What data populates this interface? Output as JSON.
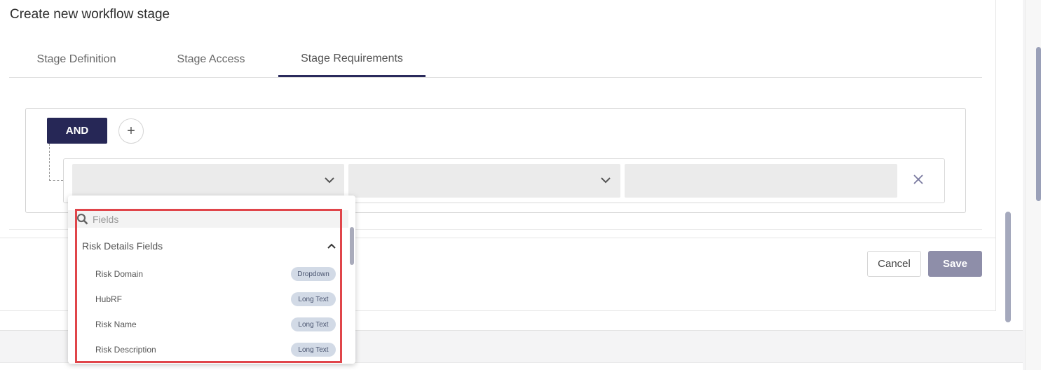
{
  "dialog": {
    "title": "Create new workflow stage"
  },
  "tabs": [
    {
      "label": "Stage Definition",
      "active": false
    },
    {
      "label": "Stage Access",
      "active": false
    },
    {
      "label": "Stage Requirements",
      "active": true
    }
  ],
  "builder": {
    "operator_label": "AND",
    "add_symbol": "+",
    "remove_symbol": "✕"
  },
  "dropdown": {
    "search_placeholder": "Fields",
    "group_label": "Risk Details Fields",
    "items": [
      {
        "label": "Risk Domain",
        "type": "Dropdown"
      },
      {
        "label": "HubRF",
        "type": "Long Text"
      },
      {
        "label": "Risk Name",
        "type": "Long Text"
      },
      {
        "label": "Risk Description",
        "type": "Long Text"
      }
    ]
  },
  "footer": {
    "cancel_label": "Cancel",
    "save_label": "Save"
  },
  "colors": {
    "operator_bg": "#262756",
    "save_bg": "#8e8ea9",
    "highlight": "#e0454a",
    "badge_bg": "#d2dae6"
  },
  "icons": {
    "search": "search-icon",
    "chevron": "chevron-down-icon",
    "caret_up": "chevron-up-icon",
    "close": "close-icon",
    "plus": "plus-icon"
  }
}
